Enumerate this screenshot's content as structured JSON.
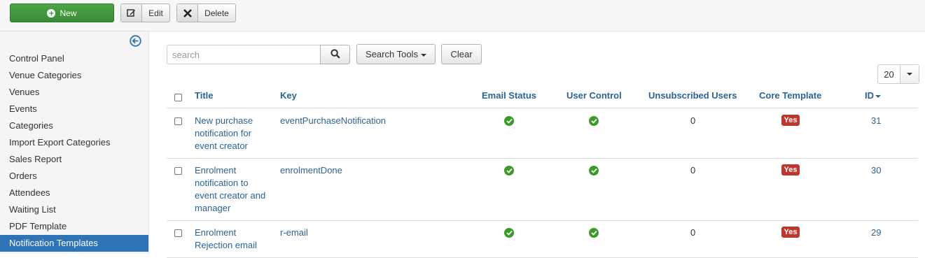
{
  "toolbar": {
    "new_label": "New",
    "edit_label": "Edit",
    "delete_label": "Delete"
  },
  "sidebar": {
    "items": [
      {
        "label": "Control Panel"
      },
      {
        "label": "Venue Categories"
      },
      {
        "label": "Venues"
      },
      {
        "label": "Events"
      },
      {
        "label": "Categories"
      },
      {
        "label": "Import Export Categories"
      },
      {
        "label": "Sales Report"
      },
      {
        "label": "Orders"
      },
      {
        "label": "Attendees"
      },
      {
        "label": "Waiting List"
      },
      {
        "label": "PDF Template"
      },
      {
        "label": "Notification Templates"
      }
    ],
    "active_index": 11
  },
  "filter": {
    "search_placeholder": "search",
    "search_tools_label": "Search Tools",
    "clear_label": "Clear",
    "limit_value": "20"
  },
  "table": {
    "columns": {
      "title": "Title",
      "key": "Key",
      "email_status": "Email Status",
      "user_control": "User Control",
      "unsubscribed": "Unsubscribed Users",
      "core_template": "Core Template",
      "id": "ID"
    },
    "rows": [
      {
        "title_lines": [
          "New purchase",
          "notification for",
          "event creator"
        ],
        "key": "eventPurchaseNotification",
        "unsubscribed": "0",
        "core": "Yes",
        "id": "31"
      },
      {
        "title_lines": [
          "Enrolment",
          "notification to",
          "event creator and",
          "manager"
        ],
        "key": "enrolmentDone",
        "unsubscribed": "0",
        "core": "Yes",
        "id": "30"
      },
      {
        "title_lines": [
          "Enrolment",
          "Rejection email"
        ],
        "key": "r-email",
        "unsubscribed": "0",
        "core": "Yes",
        "id": "29"
      }
    ]
  },
  "colors": {
    "link": "#2a6496",
    "active_nav": "#2e73b5",
    "ok_green": "#3c9a2b",
    "yes_red": "#bd362f",
    "new_green": "#45a040"
  }
}
